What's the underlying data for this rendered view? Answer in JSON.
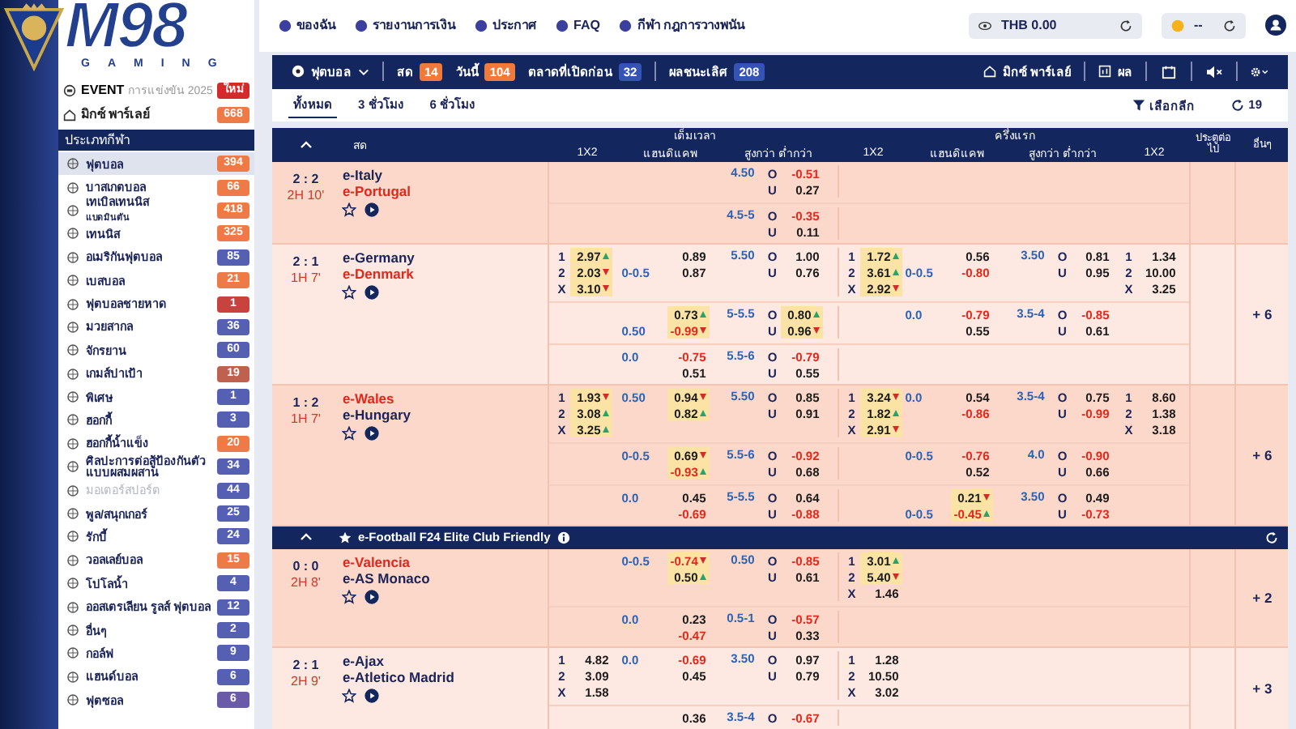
{
  "logo": {
    "text": "M98",
    "sub": "GAMING"
  },
  "nav": [
    {
      "label": "ของฉัน"
    },
    {
      "label": "รายงานการเงิน"
    },
    {
      "label": "ประกาศ"
    },
    {
      "label": "FAQ"
    },
    {
      "label": "กีฬา กฎการวางพนัน"
    }
  ],
  "wallet": {
    "currency": "THB 0.00",
    "coins": "--"
  },
  "sidebar": {
    "event": {
      "title": "EVENT",
      "subtitle": "การแข่งขัน 2025",
      "badge": "ใหม่"
    },
    "parlay": {
      "label": "มิกซ์ พาร์เลย์",
      "count": "668"
    },
    "heading": "ประเภทกีฬา",
    "sports": [
      {
        "label": "ฟุตบอล",
        "count": "394",
        "color": "#ee7a48",
        "selected": true,
        "disabled": false
      },
      {
        "label": "บาสเกตบอล",
        "count": "66",
        "color": "#ee7a48",
        "selected": false,
        "disabled": false
      },
      {
        "label": "เทเบิลเทนนิส",
        "sub": "แบดมินตัน",
        "count": "418",
        "color": "#ee7a48",
        "selected": false,
        "disabled": false
      },
      {
        "label": "เทนนิส",
        "count": "325",
        "color": "#ee7a48",
        "selected": false,
        "disabled": false
      },
      {
        "label": "อเมริกันฟุตบอล",
        "count": "85",
        "color": "#5560b3",
        "selected": false,
        "disabled": false
      },
      {
        "label": "เบสบอล",
        "count": "21",
        "color": "#ee7a48",
        "selected": false,
        "disabled": false
      },
      {
        "label": "ฟุตบอลชายหาด",
        "count": "1",
        "color": "#c8423e",
        "selected": false,
        "disabled": false
      },
      {
        "label": "มวยสากล",
        "count": "36",
        "color": "#5560b3",
        "selected": false,
        "disabled": false
      },
      {
        "label": "จักรยาน",
        "count": "60",
        "color": "#5560b3",
        "selected": false,
        "disabled": false
      },
      {
        "label": "เกมส์ปาเป้า",
        "count": "19",
        "color": "#c0614f",
        "selected": false,
        "disabled": false
      },
      {
        "label": "พิเศษ",
        "count": "1",
        "color": "#5560b3",
        "selected": false,
        "disabled": false
      },
      {
        "label": "ฮอกกี้",
        "count": "3",
        "color": "#5560b3",
        "selected": false,
        "disabled": false
      },
      {
        "label": "ฮอกกี้น้ำแข็ง",
        "count": "20",
        "color": "#ee7a48",
        "selected": false,
        "disabled": false
      },
      {
        "label": "ศิลปะการต่อสู้ป้องกันตัวแบบผสมผสาน",
        "count": "34",
        "color": "#5560b3",
        "selected": false,
        "disabled": false
      },
      {
        "label": "มอเตอร์สปอร์ต",
        "count": "44",
        "color": "#5560b3",
        "selected": false,
        "disabled": true
      },
      {
        "label": "พูล/สนุกเกอร์",
        "count": "25",
        "color": "#5560b3",
        "selected": false,
        "disabled": false
      },
      {
        "label": "รักบี้",
        "count": "24",
        "color": "#5560b3",
        "selected": false,
        "disabled": false
      },
      {
        "label": "วอลเลย์บอล",
        "count": "15",
        "color": "#ee7a48",
        "selected": false,
        "disabled": false
      },
      {
        "label": "โปโลน้ำ",
        "count": "4",
        "color": "#5560b3",
        "selected": false,
        "disabled": false
      },
      {
        "label": "ออสเตรเลียน รูลส์ ฟุตบอล",
        "count": "12",
        "color": "#5560b3",
        "selected": false,
        "disabled": false
      },
      {
        "label": "อื่นๆ",
        "count": "2",
        "color": "#5560b3",
        "selected": false,
        "disabled": false
      },
      {
        "label": "กอล์ฟ",
        "count": "9",
        "color": "#5560b3",
        "selected": false,
        "disabled": false
      },
      {
        "label": "แฮนด์บอล",
        "count": "6",
        "color": "#5560b3",
        "selected": false,
        "disabled": false
      },
      {
        "label": "ฟุตซอล",
        "count": "6",
        "color": "#6a5aa8",
        "selected": false,
        "disabled": false
      }
    ]
  },
  "sportbar": {
    "sport": "ฟุตบอล",
    "filters": [
      {
        "label": "สด",
        "count": "14",
        "color": "#f07a3c"
      },
      {
        "label": "วันนี้",
        "count": "104",
        "color": "#f07a3c"
      },
      {
        "label": "ตลาดที่เปิดก่อน",
        "count": "32",
        "color": "#3553b4"
      },
      {
        "label": "ผลชนะเลิศ",
        "count": "208",
        "color": "#3553b4"
      }
    ],
    "parlay": "มิกซ์ พาร์เลย์",
    "results": "ผล"
  },
  "tabs": [
    {
      "label": "ทั้งหมด",
      "selected": true
    },
    {
      "label": "3 ชั่วโมง",
      "selected": false
    },
    {
      "label": "6 ชั่วโมง",
      "selected": false
    }
  ],
  "league_filter": "เลือกลีก",
  "refresh_count": "19",
  "table": {
    "header": {
      "live": "สด",
      "groups": [
        {
          "title": "เต็มเวลา",
          "columns": [
            "1X2",
            "แฮนดิแคพ",
            "สูงกว่า ต่ำกว่า"
          ]
        },
        {
          "title": "ครึ่งแรก",
          "columns": [
            "1X2",
            "แฮนดิแคพ",
            "สูงกว่า ต่ำกว่า",
            "1X2"
          ]
        }
      ],
      "next_goal": "ประตูต่อไป",
      "more": "อื่นๆ"
    },
    "leagues": [
      {
        "matches": [
          {
            "score": "2 : 2",
            "time": "2H 10'",
            "teams": [
              {
                "name": "e-Italy",
                "favored": false
              },
              {
                "name": "e-Portugal",
                "favored": true
              }
            ],
            "lines": [
              {
                "cells": [
                  {
                    "kind": "empty"
                  },
                  {
                    "kind": "empty"
                  },
                  {
                    "kind": "ou",
                    "line": "4.50",
                    "rows": [
                      {
                        "side": "O",
                        "odd": "-0.51"
                      },
                      {
                        "side": "U",
                        "odd": "0.27"
                      }
                    ]
                  },
                  {
                    "kind": "empty"
                  },
                  {
                    "kind": "empty"
                  },
                  {
                    "kind": "empty"
                  },
                  {
                    "kind": "empty"
                  }
                ]
              },
              {
                "cells": [
                  {
                    "kind": "empty"
                  },
                  {
                    "kind": "empty"
                  },
                  {
                    "kind": "ou",
                    "line": "4.5-5",
                    "rows": [
                      {
                        "side": "O",
                        "odd": "-0.35"
                      },
                      {
                        "side": "U",
                        "odd": "0.11"
                      }
                    ]
                  },
                  {
                    "kind": "empty"
                  },
                  {
                    "kind": "empty"
                  },
                  {
                    "kind": "empty"
                  },
                  {
                    "kind": "empty"
                  }
                ]
              }
            ]
          },
          {
            "score": "2 : 1",
            "time": "1H 7'",
            "more": "+ 6",
            "teams": [
              {
                "name": "e-Germany",
                "favored": false
              },
              {
                "name": "e-Denmark",
                "favored": true
              }
            ],
            "lines": [
              {
                "cells": [
                  {
                    "kind": "x12",
                    "rows": [
                      {
                        "label": "1",
                        "odd": "2.97",
                        "up": true
                      },
                      {
                        "label": "2",
                        "odd": "2.03",
                        "up": false
                      },
                      {
                        "label": "X",
                        "odd": "3.10",
                        "up": false
                      }
                    ]
                  },
                  {
                    "kind": "hdp",
                    "rows": [
                      {
                        "odd": "0.89"
                      },
                      {
                        "line": "0-0.5",
                        "odd": "0.87"
                      }
                    ]
                  },
                  {
                    "kind": "ou",
                    "line": "5.50",
                    "rows": [
                      {
                        "side": "O",
                        "odd": "1.00"
                      },
                      {
                        "side": "U",
                        "odd": "0.76"
                      }
                    ]
                  },
                  {
                    "kind": "x12",
                    "rows": [
                      {
                        "label": "1",
                        "odd": "1.72",
                        "up": true
                      },
                      {
                        "label": "2",
                        "odd": "3.61",
                        "up": true
                      },
                      {
                        "label": "X",
                        "odd": "2.92",
                        "up": false
                      }
                    ]
                  },
                  {
                    "kind": "hdp",
                    "rows": [
                      {
                        "odd": "0.56"
                      },
                      {
                        "line": "0-0.5",
                        "odd": "-0.80"
                      }
                    ]
                  },
                  {
                    "kind": "ou",
                    "line": "3.50",
                    "rows": [
                      {
                        "side": "O",
                        "odd": "0.81"
                      },
                      {
                        "side": "U",
                        "odd": "0.95"
                      }
                    ]
                  },
                  {
                    "kind": "x12",
                    "rows": [
                      {
                        "label": "1",
                        "odd": "1.34"
                      },
                      {
                        "label": "2",
                        "odd": "10.00"
                      },
                      {
                        "label": "X",
                        "odd": "3.25"
                      }
                    ]
                  }
                ]
              },
              {
                "cells": [
                  {
                    "kind": "empty"
                  },
                  {
                    "kind": "hdp",
                    "rows": [
                      {
                        "odd": "0.73",
                        "up": true
                      },
                      {
                        "line": "0.50",
                        "odd": "-0.99",
                        "up": false
                      }
                    ]
                  },
                  {
                    "kind": "ou",
                    "line": "5-5.5",
                    "rows": [
                      {
                        "side": "O",
                        "odd": "0.80",
                        "up": true
                      },
                      {
                        "side": "U",
                        "odd": "0.96",
                        "up": false
                      }
                    ]
                  },
                  {
                    "kind": "empty"
                  },
                  {
                    "kind": "hdp",
                    "rows": [
                      {
                        "line": "0.0",
                        "odd": "-0.79"
                      },
                      {
                        "odd": "0.55"
                      }
                    ]
                  },
                  {
                    "kind": "ou",
                    "line": "3.5-4",
                    "rows": [
                      {
                        "side": "O",
                        "odd": "-0.85"
                      },
                      {
                        "side": "U",
                        "odd": "0.61"
                      }
                    ]
                  },
                  {
                    "kind": "empty"
                  }
                ]
              },
              {
                "cells": [
                  {
                    "kind": "empty"
                  },
                  {
                    "kind": "hdp",
                    "rows": [
                      {
                        "line": "0.0",
                        "odd": "-0.75"
                      },
                      {
                        "odd": "0.51"
                      }
                    ]
                  },
                  {
                    "kind": "ou",
                    "line": "5.5-6",
                    "rows": [
                      {
                        "side": "O",
                        "odd": "-0.79"
                      },
                      {
                        "side": "U",
                        "odd": "0.55"
                      }
                    ]
                  },
                  {
                    "kind": "empty"
                  },
                  {
                    "kind": "empty"
                  },
                  {
                    "kind": "empty"
                  },
                  {
                    "kind": "empty"
                  }
                ]
              }
            ]
          },
          {
            "score": "1 : 2",
            "time": "1H 7'",
            "more": "+ 6",
            "teams": [
              {
                "name": "e-Wales",
                "favored": true
              },
              {
                "name": "e-Hungary",
                "favored": false
              }
            ],
            "lines": [
              {
                "cells": [
                  {
                    "kind": "x12",
                    "rows": [
                      {
                        "label": "1",
                        "odd": "1.93",
                        "up": false
                      },
                      {
                        "label": "2",
                        "odd": "3.08",
                        "up": true
                      },
                      {
                        "label": "X",
                        "odd": "3.25",
                        "up": true
                      }
                    ]
                  },
                  {
                    "kind": "hdp",
                    "rows": [
                      {
                        "line": "0.50",
                        "odd": "0.94",
                        "up": false
                      },
                      {
                        "odd": "0.82",
                        "up": true
                      }
                    ]
                  },
                  {
                    "kind": "ou",
                    "line": "5.50",
                    "rows": [
                      {
                        "side": "O",
                        "odd": "0.85"
                      },
                      {
                        "side": "U",
                        "odd": "0.91"
                      }
                    ]
                  },
                  {
                    "kind": "x12",
                    "rows": [
                      {
                        "label": "1",
                        "odd": "3.24",
                        "up": false
                      },
                      {
                        "label": "2",
                        "odd": "1.82",
                        "up": true
                      },
                      {
                        "label": "X",
                        "odd": "2.91",
                        "up": false
                      }
                    ]
                  },
                  {
                    "kind": "hdp",
                    "rows": [
                      {
                        "line": "0.0",
                        "odd": "0.54"
                      },
                      {
                        "odd": "-0.86"
                      }
                    ]
                  },
                  {
                    "kind": "ou",
                    "line": "3.5-4",
                    "rows": [
                      {
                        "side": "O",
                        "odd": "0.75"
                      },
                      {
                        "side": "U",
                        "odd": "-0.99"
                      }
                    ]
                  },
                  {
                    "kind": "x12",
                    "rows": [
                      {
                        "label": "1",
                        "odd": "8.60"
                      },
                      {
                        "label": "2",
                        "odd": "1.38"
                      },
                      {
                        "label": "X",
                        "odd": "3.18"
                      }
                    ]
                  }
                ]
              },
              {
                "cells": [
                  {
                    "kind": "empty"
                  },
                  {
                    "kind": "hdp",
                    "rows": [
                      {
                        "line": "0-0.5",
                        "odd": "0.69",
                        "up": false
                      },
                      {
                        "odd": "-0.93",
                        "up": true
                      }
                    ]
                  },
                  {
                    "kind": "ou",
                    "line": "5.5-6",
                    "rows": [
                      {
                        "side": "O",
                        "odd": "-0.92"
                      },
                      {
                        "side": "U",
                        "odd": "0.68"
                      }
                    ]
                  },
                  {
                    "kind": "empty"
                  },
                  {
                    "kind": "hdp",
                    "rows": [
                      {
                        "line": "0-0.5",
                        "odd": "-0.76"
                      },
                      {
                        "odd": "0.52"
                      }
                    ]
                  },
                  {
                    "kind": "ou",
                    "line": "4.0",
                    "rows": [
                      {
                        "side": "O",
                        "odd": "-0.90"
                      },
                      {
                        "side": "U",
                        "odd": "0.66"
                      }
                    ]
                  },
                  {
                    "kind": "empty"
                  }
                ]
              },
              {
                "cells": [
                  {
                    "kind": "empty"
                  },
                  {
                    "kind": "hdp",
                    "rows": [
                      {
                        "line": "0.0",
                        "odd": "0.45"
                      },
                      {
                        "odd": "-0.69"
                      }
                    ]
                  },
                  {
                    "kind": "ou",
                    "line": "5-5.5",
                    "rows": [
                      {
                        "side": "O",
                        "odd": "0.64"
                      },
                      {
                        "side": "U",
                        "odd": "-0.88"
                      }
                    ]
                  },
                  {
                    "kind": "empty"
                  },
                  {
                    "kind": "hdp",
                    "rows": [
                      {
                        "odd": "0.21",
                        "up": false
                      },
                      {
                        "line": "0-0.5",
                        "odd": "-0.45",
                        "up": true
                      }
                    ]
                  },
                  {
                    "kind": "ou",
                    "line": "3.50",
                    "rows": [
                      {
                        "side": "O",
                        "odd": "0.49"
                      },
                      {
                        "side": "U",
                        "odd": "-0.73"
                      }
                    ]
                  },
                  {
                    "kind": "empty"
                  }
                ]
              }
            ]
          }
        ]
      },
      {
        "title": "e-Football F24 Elite Club Friendly",
        "matches": [
          {
            "score": "0 : 0",
            "time": "2H 8'",
            "more": "+ 2",
            "teams": [
              {
                "name": "e-Valencia",
                "favored": true
              },
              {
                "name": "e-AS Monaco",
                "favored": false
              }
            ],
            "lines": [
              {
                "cells": [
                  {
                    "kind": "empty"
                  },
                  {
                    "kind": "hdp",
                    "rows": [
                      {
                        "line": "0-0.5",
                        "odd": "-0.74",
                        "up": false
                      },
                      {
                        "odd": "0.50",
                        "up": true
                      }
                    ]
                  },
                  {
                    "kind": "ou",
                    "line": "0.50",
                    "rows": [
                      {
                        "side": "O",
                        "odd": "-0.85"
                      },
                      {
                        "side": "U",
                        "odd": "0.61"
                      }
                    ]
                  },
                  {
                    "kind": "x12",
                    "rows": [
                      {
                        "label": "1",
                        "odd": "3.01",
                        "up": true
                      },
                      {
                        "label": "2",
                        "odd": "5.40",
                        "up": false
                      },
                      {
                        "label": "X",
                        "odd": "1.46"
                      }
                    ]
                  },
                  {
                    "kind": "empty"
                  },
                  {
                    "kind": "empty"
                  },
                  {
                    "kind": "empty"
                  }
                ]
              },
              {
                "cells": [
                  {
                    "kind": "empty"
                  },
                  {
                    "kind": "hdp",
                    "rows": [
                      {
                        "line": "0.0",
                        "odd": "0.23"
                      },
                      {
                        "odd": "-0.47"
                      }
                    ]
                  },
                  {
                    "kind": "ou",
                    "line": "0.5-1",
                    "rows": [
                      {
                        "side": "O",
                        "odd": "-0.57"
                      },
                      {
                        "side": "U",
                        "odd": "0.33"
                      }
                    ]
                  },
                  {
                    "kind": "empty"
                  },
                  {
                    "kind": "empty"
                  },
                  {
                    "kind": "empty"
                  },
                  {
                    "kind": "empty"
                  }
                ]
              }
            ]
          },
          {
            "score": "2 : 1",
            "time": "2H 9'",
            "more": "+ 3",
            "teams": [
              {
                "name": "e-Ajax",
                "favored": false
              },
              {
                "name": "e-Atletico Madrid",
                "favored": false
              }
            ],
            "lines": [
              {
                "cells": [
                  {
                    "kind": "x12",
                    "rows": [
                      {
                        "label": "1",
                        "odd": "4.82"
                      },
                      {
                        "label": "2",
                        "odd": "3.09"
                      },
                      {
                        "label": "X",
                        "odd": "1.58"
                      }
                    ]
                  },
                  {
                    "kind": "hdp",
                    "rows": [
                      {
                        "line": "0.0",
                        "odd": "-0.69"
                      },
                      {
                        "odd": "0.45"
                      }
                    ]
                  },
                  {
                    "kind": "ou",
                    "line": "3.50",
                    "rows": [
                      {
                        "side": "O",
                        "odd": "0.97"
                      },
                      {
                        "side": "U",
                        "odd": "0.79"
                      }
                    ]
                  },
                  {
                    "kind": "x12",
                    "rows": [
                      {
                        "label": "1",
                        "odd": "1.28"
                      },
                      {
                        "label": "2",
                        "odd": "10.50"
                      },
                      {
                        "label": "X",
                        "odd": "3.02"
                      }
                    ]
                  },
                  {
                    "kind": "empty"
                  },
                  {
                    "kind": "empty"
                  },
                  {
                    "kind": "empty"
                  }
                ]
              },
              {
                "cells": [
                  {
                    "kind": "empty"
                  },
                  {
                    "kind": "hdp",
                    "rows": [
                      {
                        "odd": "0.36"
                      }
                    ]
                  },
                  {
                    "kind": "ou",
                    "line": "3.5-4",
                    "rows": [
                      {
                        "side": "O",
                        "odd": "-0.67"
                      }
                    ]
                  },
                  {
                    "kind": "empty"
                  },
                  {
                    "kind": "empty"
                  },
                  {
                    "kind": "empty"
                  },
                  {
                    "kind": "empty"
                  }
                ]
              }
            ]
          }
        ]
      }
    ]
  }
}
